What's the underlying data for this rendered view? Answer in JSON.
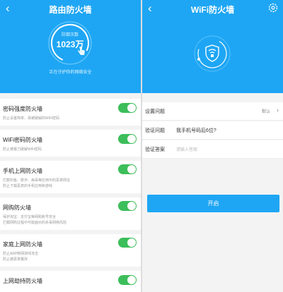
{
  "left": {
    "title": "路由防火墙",
    "back_icon": "back-chevron-icon",
    "gauge": {
      "label": "防御次数",
      "value": "1023万",
      "icon": "hand-pointer-icon"
    },
    "status": "正在守护你的网络安全",
    "items": [
      {
        "label": "密码强度防火墙",
        "desc": [
          "防止设置简单、易被破解的WiFi密码"
        ],
        "enabled": true
      },
      {
        "label": "WiFi密码防火墙",
        "desc": [
          "防止被暴力破解WiFi密码"
        ],
        "enabled": true
      },
      {
        "label": "手机上网防火墙",
        "desc": [
          "拦截钓鱼、欺诈、病毒等应用中的恶意网址",
          "防止下载恶意的手机应用和游戏"
        ],
        "enabled": true
      },
      {
        "label": "网购防火墙",
        "desc": [
          "保护淘宝、支付宝等网购账号安全",
          "拦截网购过程中可能面对的杀毒网络风险"
        ],
        "enabled": true
      },
      {
        "label": "家庭上网防火墙",
        "desc": [
          "防止ARP断网掉线攻击",
          "防止被恶意篡改"
        ],
        "enabled": true
      },
      {
        "label": "上网劫持防火墙",
        "desc": [],
        "enabled": true
      }
    ]
  },
  "right": {
    "title": "WiFi防火墙",
    "back_icon": "back-chevron-icon",
    "settings_icon": "gear-icon",
    "shield_icon": "wifi-shield-icon",
    "fields": {
      "question_setting": {
        "label": "设置问题",
        "value": "默认"
      },
      "verify_question": {
        "label": "验证问题",
        "value": "我手机号码后6位?"
      },
      "verify_answer": {
        "label": "验证答案",
        "placeholder": "请输入答案"
      }
    },
    "button": "开启"
  },
  "colors": {
    "primary": "#1ea6f4",
    "toggle_on": "#3cbe5a"
  }
}
